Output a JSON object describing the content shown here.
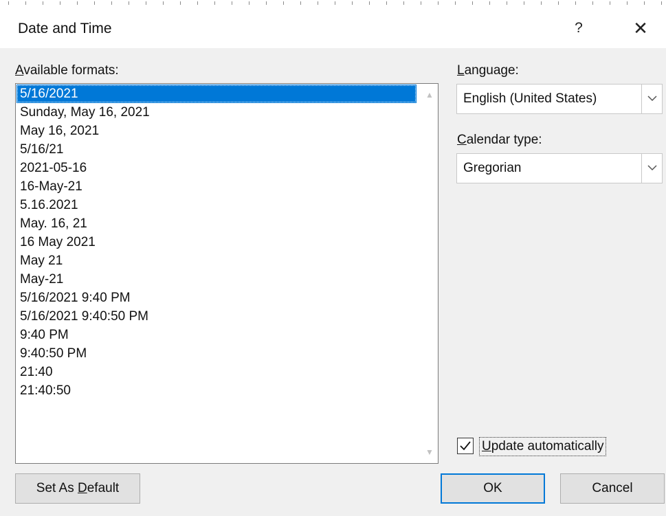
{
  "dialog": {
    "title": "Date and Time",
    "help_label": "?",
    "close_label": "✕"
  },
  "formats": {
    "label": "Available formats:",
    "label_access_key": "A",
    "label_rest": "vailable formats:",
    "selected_index": 0,
    "items": [
      "5/16/2021",
      "Sunday, May 16, 2021",
      "May 16, 2021",
      "5/16/21",
      "2021-05-16",
      "16-May-21",
      "5.16.2021",
      "May. 16, 21",
      "16 May 2021",
      "May 21",
      "May-21",
      "5/16/2021 9:40 PM",
      "5/16/2021 9:40:50 PM",
      "9:40 PM",
      "9:40:50 PM",
      "21:40",
      "21:40:50"
    ]
  },
  "language": {
    "label_access_key": "L",
    "label_rest": "anguage:",
    "value": "English (United States)"
  },
  "calendar": {
    "label_access_key": "C",
    "label_rest": "alendar type:",
    "value": "Gregorian"
  },
  "update": {
    "label_access_key": "U",
    "label_rest": "pdate automatically",
    "checked": true
  },
  "buttons": {
    "set_default_prefix": "Set As ",
    "set_default_key": "D",
    "set_default_rest": "efault",
    "ok": "OK",
    "cancel": "Cancel"
  },
  "colors": {
    "selection": "#0078d7",
    "dialog_bg": "#f0f0f0",
    "button_bg": "#e1e1e1"
  }
}
